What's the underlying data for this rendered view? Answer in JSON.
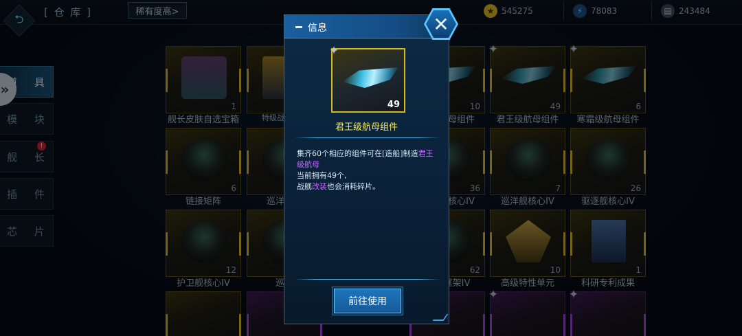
{
  "header": {
    "back_icon": "back-arrow-icon",
    "title": "[ 仓 库 ]",
    "sort_label": "稀有度高>"
  },
  "resources": [
    {
      "icon": "coin-icon",
      "value": "545275",
      "color": "#d9b51f"
    },
    {
      "icon": "energy-icon",
      "value": "78083",
      "color": "#4aa8e8"
    },
    {
      "icon": "alloy-icon",
      "value": "243484",
      "color": "#7d8fa0"
    }
  ],
  "sidebar": {
    "items": [
      {
        "label": "道 具",
        "active": true
      },
      {
        "label": "模 块"
      },
      {
        "label": "舰 长",
        "badge": "!"
      },
      {
        "label": "插 件"
      },
      {
        "label": "芯 片"
      }
    ]
  },
  "grid": {
    "items": [
      {
        "name": "舰长皮肤自选宝箱",
        "count": "1",
        "rarity": "gold"
      },
      {
        "name": "特级战舰自选",
        "count": "",
        "rarity": "gold"
      },
      {
        "name": "航母组件",
        "count": "10",
        "rarity": "gold"
      },
      {
        "name": "君王级航母组件",
        "count": "49",
        "rarity": "gold"
      },
      {
        "name": "寒霜级航母组件",
        "count": "6",
        "rarity": "gold"
      },
      {
        "name": "链接矩阵",
        "count": "6",
        "rarity": "gold"
      },
      {
        "name": "巡洋舰护",
        "count": "",
        "rarity": "gold"
      },
      {
        "name": "盾核心IV",
        "count": "36",
        "rarity": "gold"
      },
      {
        "name": "巡洋舰核心IV",
        "count": "7",
        "rarity": "gold"
      },
      {
        "name": "驱逐舰核心IV",
        "count": "26",
        "rarity": "gold"
      },
      {
        "name": "护卫舰核心IV",
        "count": "12",
        "rarity": "gold"
      },
      {
        "name": "巡洋",
        "count": "",
        "rarity": "gold"
      },
      {
        "name": "框架IV",
        "count": "62",
        "rarity": "gold"
      },
      {
        "name": "高级特性单元",
        "count": "10",
        "rarity": "gold"
      },
      {
        "name": "科研专利成果",
        "count": "1",
        "rarity": "gold"
      }
    ]
  },
  "dialog": {
    "title": "信息",
    "close_icon": "close-x-icon",
    "item": {
      "name": "君王级航母组件",
      "count": "49",
      "fragment_icon": "puzzle-piece-icon"
    },
    "description": {
      "line1_prefix": "集齐60个相应的组件可在[造船]制造",
      "line1_highlight": "君王级航母",
      "line2": "当前拥有49个,",
      "line3_prefix": "战舰",
      "line3_highlight": "改装",
      "line3_suffix": "也会消耗碎片。"
    },
    "action_label": "前往使用"
  }
}
